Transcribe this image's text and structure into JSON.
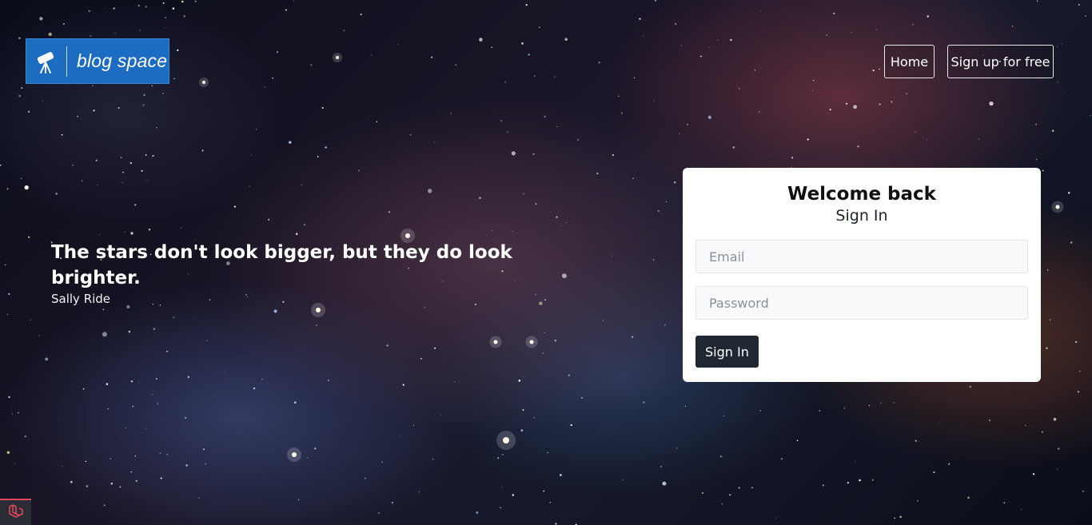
{
  "brand": {
    "logo_text": "blog space",
    "logo_icon": "telescope-icon",
    "color": "#1c6dc1"
  },
  "nav": {
    "home_label": "Home",
    "signup_label": "Sign up for free"
  },
  "hero": {
    "quote": "The stars don't look bigger, but they do look brighter.",
    "author": "Sally Ride"
  },
  "login": {
    "title": "Welcome back",
    "subtitle": "Sign In",
    "email_placeholder": "Email",
    "password_placeholder": "Password",
    "submit_label": "Sign In",
    "button_color": "#1f2733"
  },
  "debug_badge": {
    "icon": "laravel-icon",
    "accent": "#e0475a"
  }
}
